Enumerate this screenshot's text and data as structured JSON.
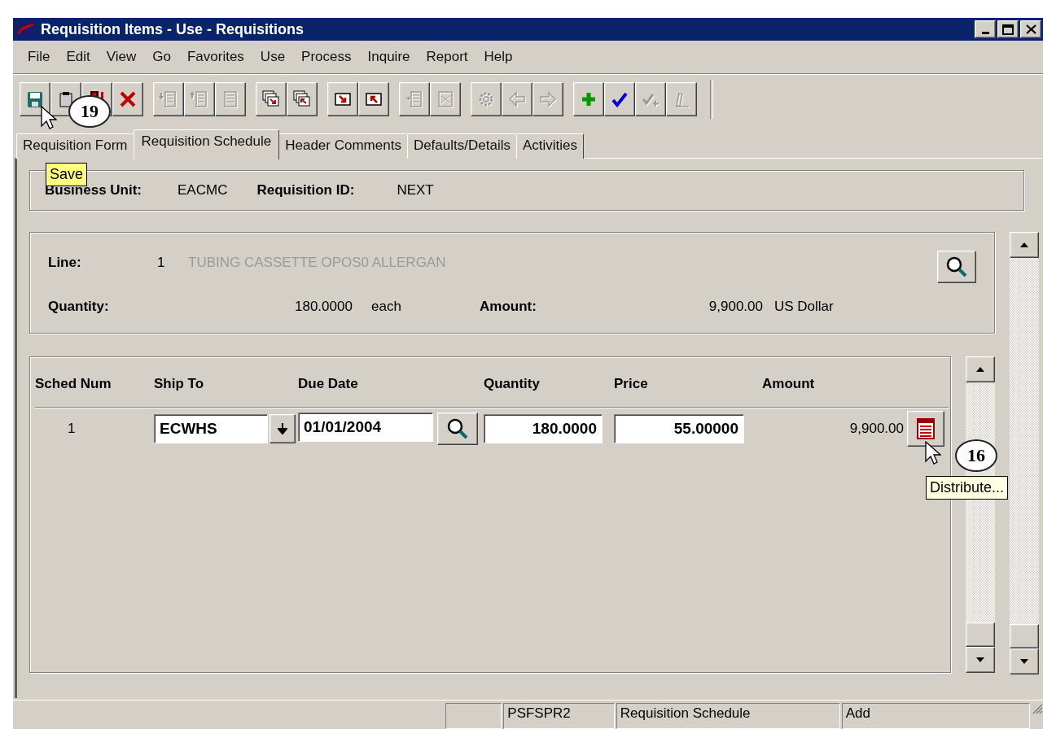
{
  "window": {
    "title": "Requisition Items - Use - Requisitions"
  },
  "menu": [
    {
      "label": "File"
    },
    {
      "label": "Edit"
    },
    {
      "label": "View"
    },
    {
      "label": "Go"
    },
    {
      "label": "Favorites"
    },
    {
      "label": "Use"
    },
    {
      "label": "Process"
    },
    {
      "label": "Inquire"
    },
    {
      "label": "Report"
    },
    {
      "label": "Help"
    }
  ],
  "toolbar": [
    [
      {
        "kind": "save",
        "disabled": false
      },
      {
        "kind": "clipboard",
        "disabled": false
      },
      {
        "kind": "traffic-light",
        "disabled": false
      },
      {
        "kind": "delete",
        "disabled": false
      }
    ],
    [
      {
        "kind": "list-down",
        "disabled": true
      },
      {
        "kind": "list-up",
        "disabled": true
      },
      {
        "kind": "list",
        "disabled": true
      }
    ],
    [
      {
        "kind": "window-next",
        "disabled": false
      },
      {
        "kind": "window-prev",
        "disabled": false
      }
    ],
    [
      {
        "kind": "arrow-down-right",
        "disabled": false
      },
      {
        "kind": "arrow-up-left",
        "disabled": false
      }
    ],
    [
      {
        "kind": "list-insert",
        "disabled": true
      },
      {
        "kind": "list-delete",
        "disabled": true
      }
    ],
    [
      {
        "kind": "gear",
        "disabled": true
      },
      {
        "kind": "prev",
        "disabled": true
      },
      {
        "kind": "next",
        "disabled": true
      }
    ],
    [
      {
        "kind": "add",
        "disabled": false
      },
      {
        "kind": "check",
        "disabled": false
      },
      {
        "kind": "check-add",
        "disabled": true
      },
      {
        "kind": "pencil",
        "disabled": true
      }
    ]
  ],
  "tabs": [
    {
      "label": "Requisition Form",
      "selected": false
    },
    {
      "label": "Requisition Schedule",
      "selected": true
    },
    {
      "label": "Header Comments",
      "selected": false
    },
    {
      "label": "Defaults/Details",
      "selected": false
    },
    {
      "label": "Activities",
      "selected": false
    }
  ],
  "header": [
    {
      "label": "Business Unit:",
      "value": "EACMC"
    },
    {
      "label": "Requisition ID:",
      "value": "NEXT"
    }
  ],
  "line_info": {
    "line_label": "Line:",
    "line_number": "1",
    "description": "TUBING CASSETTE OPOS0 ALLERGAN",
    "description_disabled": true,
    "quantity_label": "Quantity:",
    "quantity": "180.0000",
    "unit": "each",
    "amount_label": "Amount:",
    "amount": "9,900.00",
    "currency": "US Dollar"
  },
  "schedule": {
    "columns": [
      "Sched Num",
      "Ship To",
      "Due Date",
      "Quantity",
      "Price",
      "Amount"
    ],
    "rows": [
      {
        "sched_num": "1",
        "ship_to": "ECWHS",
        "due_date": "01/01/2004",
        "quantity": "180.0000",
        "price": "55.00000",
        "amount": "9,900.00"
      }
    ]
  },
  "tooltips": [
    {
      "text": "Save"
    },
    {
      "text": "Distribute..."
    }
  ],
  "callouts": [
    "19",
    "16"
  ],
  "status_bar": [
    "PSFSPR2",
    "Requisition Schedule",
    "Add"
  ]
}
